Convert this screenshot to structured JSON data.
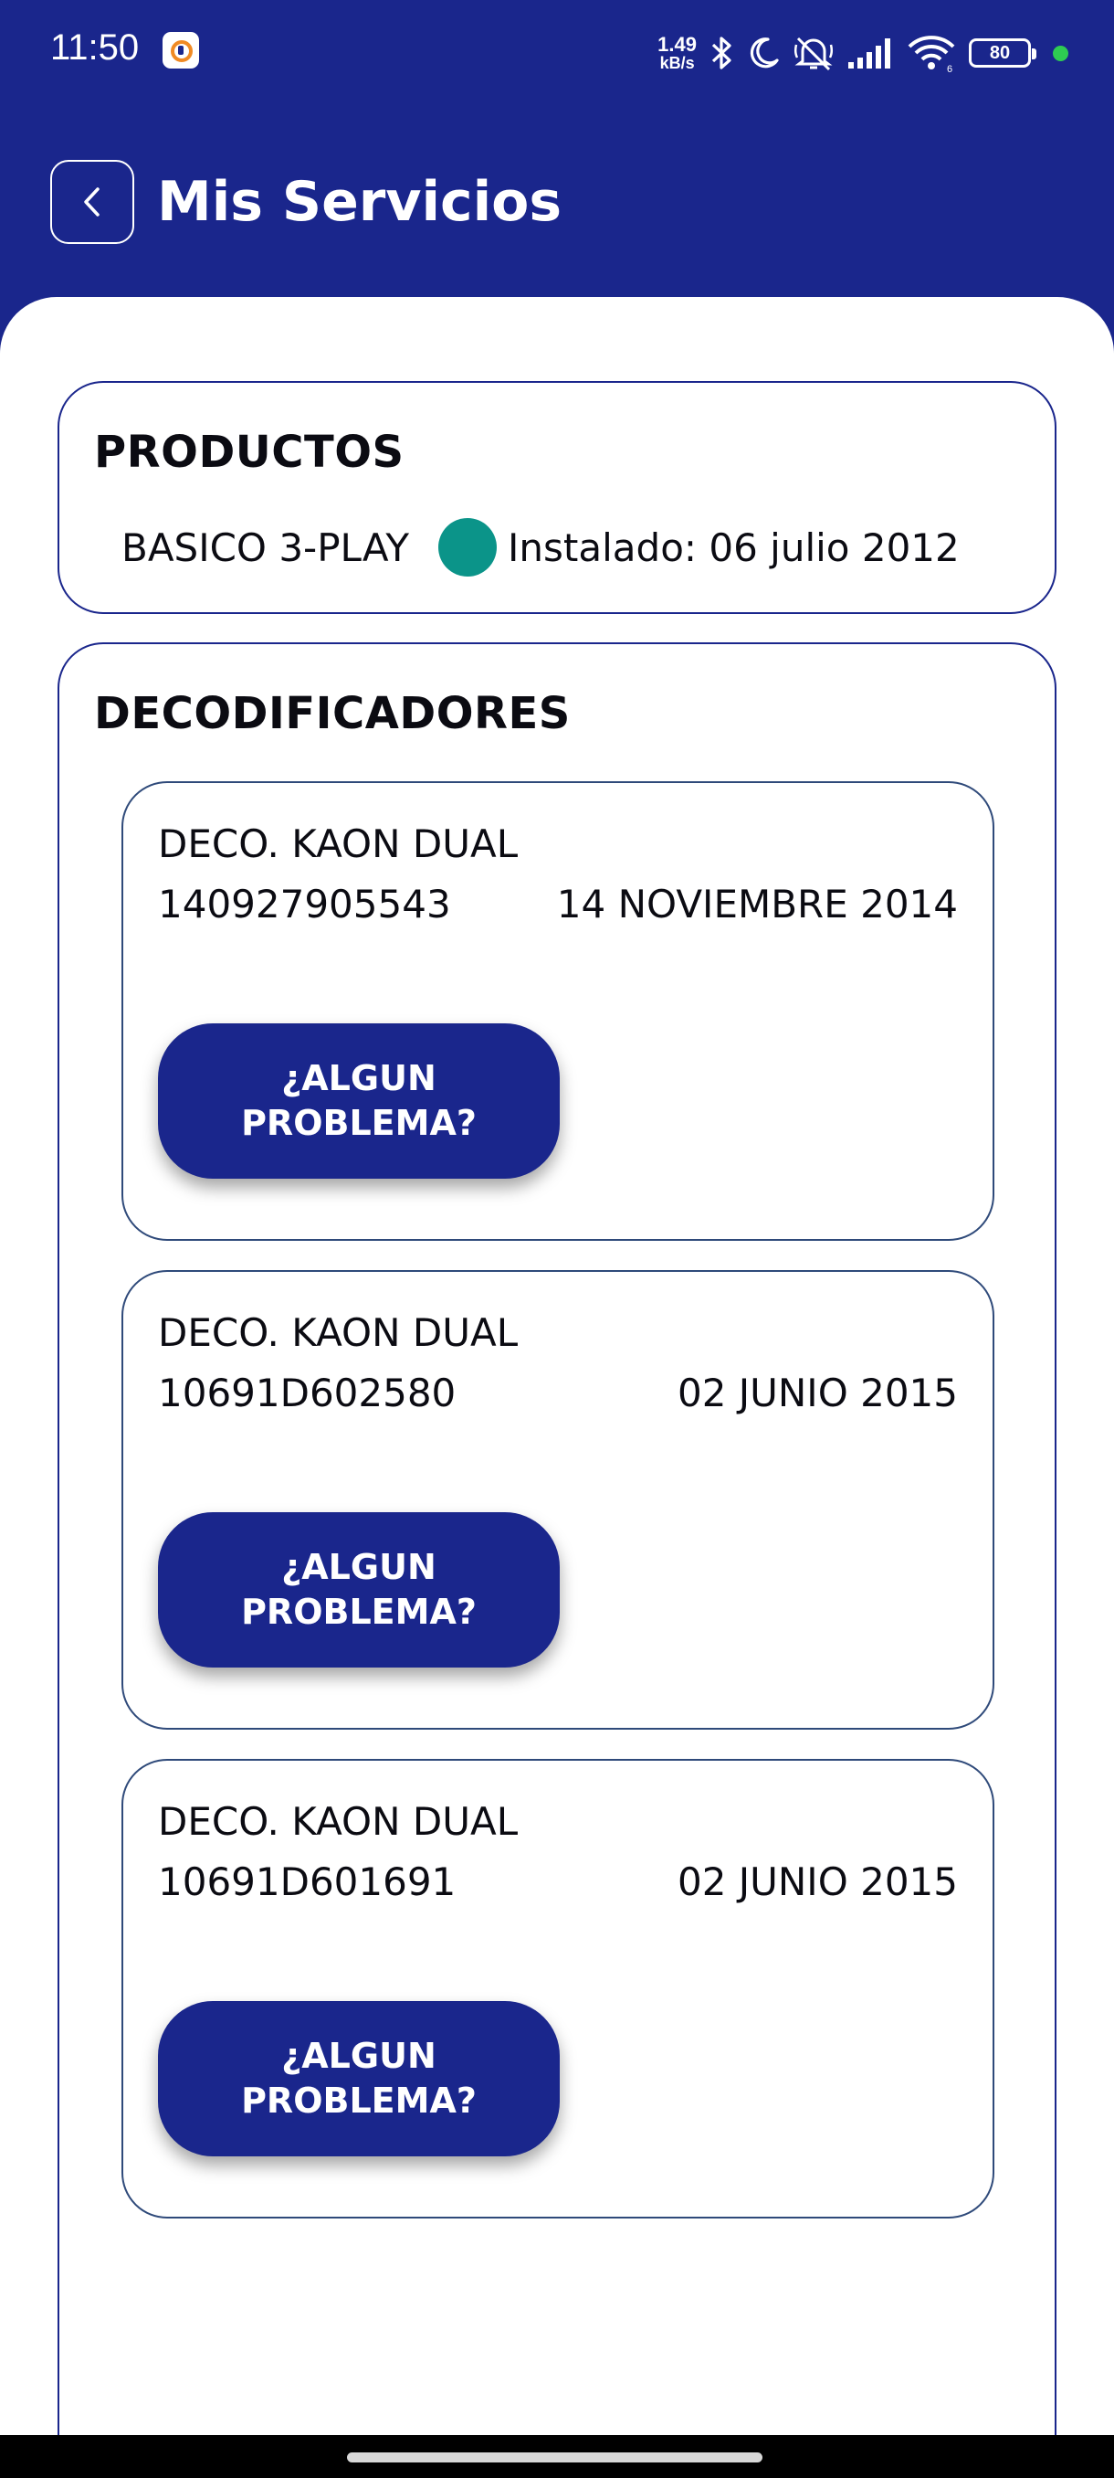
{
  "status_bar": {
    "time": "11:50",
    "net_speed_value": "1.49",
    "net_speed_unit": "kB/s",
    "battery": "80",
    "icons": [
      "vpn-app-icon",
      "bluetooth-icon",
      "moon-icon",
      "mute-icon",
      "signal-icon",
      "wifi-icon",
      "battery-icon"
    ]
  },
  "header": {
    "title": "Mis Servicios"
  },
  "products": {
    "title": "PRODUCTOS",
    "name": "BASICO 3-PLAY",
    "install_text": "Instalado: 06 julio 2012",
    "status_color": "#0b9489"
  },
  "decoders": {
    "title": "DECODIFICADORES",
    "items": [
      {
        "name": "DECO. KAON DUAL",
        "serial": "140927905543",
        "date": "14 NOVIEMBRE 2014",
        "button": "¿ALGUN PROBLEMA?"
      },
      {
        "name": "DECO. KAON DUAL",
        "serial": "10691D602580",
        "date": "02 JUNIO 2015",
        "button": "¿ALGUN PROBLEMA?"
      },
      {
        "name": "DECO. KAON DUAL",
        "serial": "10691D601691",
        "date": "02 JUNIO 2015",
        "button": "¿ALGUN PROBLEMA?"
      }
    ]
  },
  "colors": {
    "primary": "#1a268c",
    "status_green": "#0b9489"
  }
}
